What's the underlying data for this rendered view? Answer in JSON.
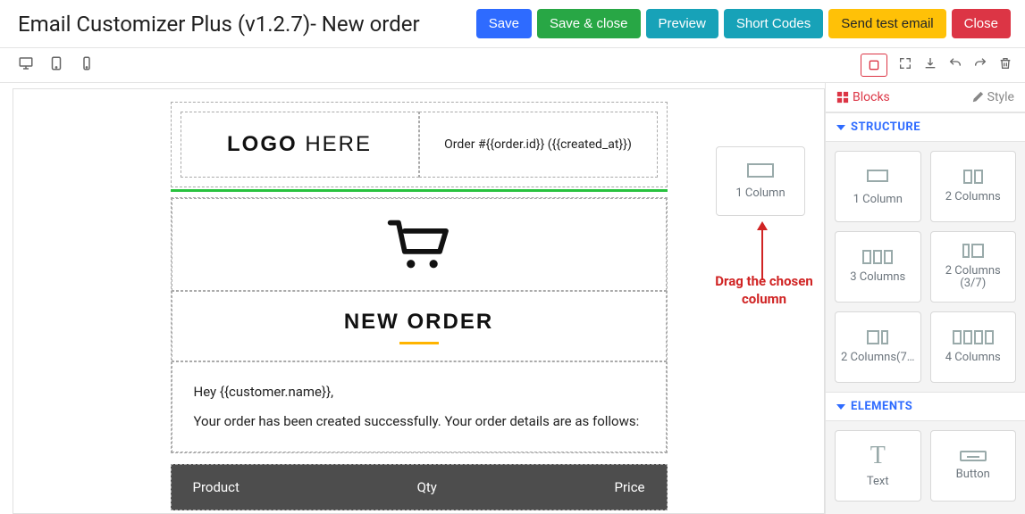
{
  "header": {
    "title": "Email Customizer Plus (v1.2.7)- New order",
    "actions": {
      "save": "Save",
      "save_close": "Save & close",
      "preview": "Preview",
      "short_codes": "Short Codes",
      "send_test": "Send test email",
      "close": "Close"
    }
  },
  "sidebar": {
    "tabs": {
      "blocks": "Blocks",
      "style": "Style"
    },
    "sections": {
      "structure": "STRUCTURE",
      "elements": "ELEMENTS"
    },
    "structure": [
      {
        "label": "1 Column"
      },
      {
        "label": "2 Columns"
      },
      {
        "label": "3 Columns"
      },
      {
        "label": "2 Columns (3/7)"
      },
      {
        "label": "2 Columns(7…"
      },
      {
        "label": "4 Columns"
      }
    ],
    "elements": [
      {
        "label": "Text"
      },
      {
        "label": "Button"
      }
    ]
  },
  "canvas": {
    "logo_bold": "LOGO",
    "logo_rest": " HERE",
    "order_meta": "Order #{{order.id}} ({{created_at}})",
    "heading": "NEW ORDER",
    "greeting": "Hey {{customer.name}},",
    "body1": "Your order has been created successfully. Your order details are as follows:",
    "table": {
      "c1": "Product",
      "c2": "Qty",
      "c3": "Price"
    }
  },
  "ghost": {
    "label": "1 Column"
  },
  "annotation": "Drag the chosen column"
}
